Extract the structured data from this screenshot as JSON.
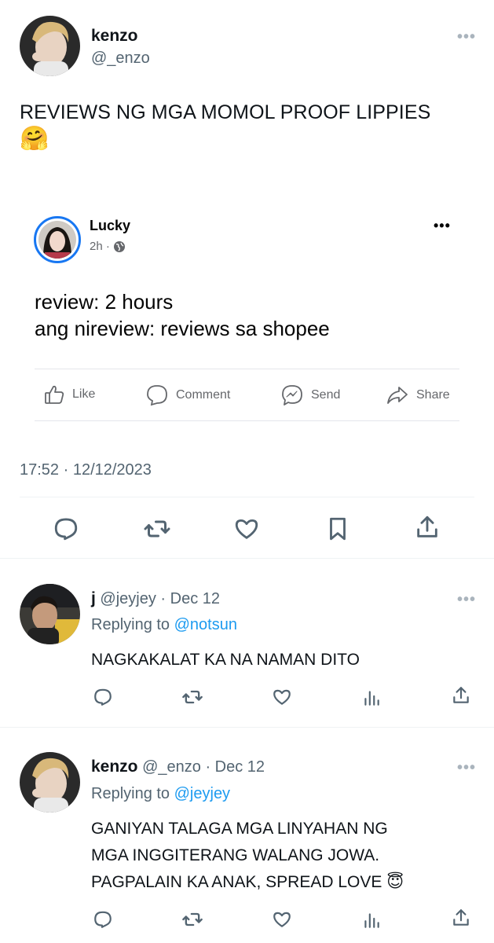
{
  "main_tweet": {
    "author_name": "kenzo",
    "author_handle": "@_enzo",
    "more_label": "•••",
    "text": "REVIEWS NG MGA MOMOL PROOF LIPPIES",
    "emoji": "🤗",
    "timestamp": "17:52 · 12/12/2023"
  },
  "embedded_fb_post": {
    "author_name": "Lucky",
    "time": "2h ·",
    "more_label": "•••",
    "text_line1": "review: 2 hours",
    "text_line2": "ang nireview: reviews sa shopee",
    "actions": {
      "like": "Like",
      "comment": "Comment",
      "send": "Send",
      "share": "Share"
    }
  },
  "replies": [
    {
      "author_name": "j",
      "author_handle": "@jeyjey",
      "date": "· Dec 12",
      "replying_label": "Replying to",
      "replying_to": "@notsun",
      "text": "NAGKAKALAT KA NA NAMAN DITO",
      "more_label": "•••"
    },
    {
      "author_name": "kenzo",
      "author_handle": "@_enzo",
      "date": "· Dec 12",
      "replying_label": "Replying to",
      "replying_to": "@jeyjey",
      "text_line1": "GANIYAN TALAGA MGA LINYAHAN NG",
      "text_line2": "MGA INGGITERANG WALANG JOWA.",
      "text_line3": "PAGPALAIN KA ANAK, SPREAD LOVE",
      "emoji": "😇",
      "more_label": "•••"
    }
  ],
  "colors": {
    "accent": "#1d9bf0",
    "secondary_text": "#536471",
    "icon": "#536471"
  }
}
